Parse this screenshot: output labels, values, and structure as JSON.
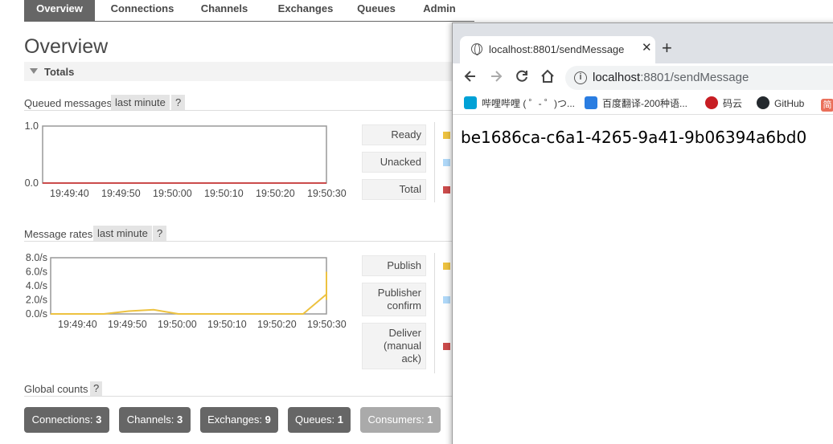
{
  "nav": {
    "tabs": [
      {
        "label": "Overview",
        "active": true
      },
      {
        "label": "Connections",
        "active": false
      },
      {
        "label": "Channels",
        "active": false
      },
      {
        "label": "Exchanges",
        "active": false
      },
      {
        "label": "Queues",
        "active": false
      },
      {
        "label": "Admin",
        "active": false
      }
    ]
  },
  "page_title": "Overview",
  "totals_label": "Totals",
  "queued": {
    "title": "Queued messages",
    "range": "last minute",
    "help": "?",
    "legend": [
      {
        "label": "Ready",
        "color": "#edc240"
      },
      {
        "label": "Unacked",
        "color": "#afd8f8"
      },
      {
        "label": "Total",
        "color": "#cb4b4b"
      }
    ]
  },
  "rates": {
    "title": "Message rates",
    "range": "last minute",
    "help": "?",
    "legend": [
      {
        "label": "Publish",
        "color": "#edc240"
      },
      {
        "label": "Publisher confirm",
        "lines": [
          "Publisher",
          "confirm"
        ],
        "color": "#afd8f8"
      },
      {
        "label": "Deliver (manual ack)",
        "lines": [
          "Deliver",
          "(manual",
          "ack)"
        ],
        "color": "#cb4b4b"
      }
    ]
  },
  "chart_data": [
    {
      "type": "line",
      "title": "Queued messages",
      "x": [
        "19:49:40",
        "19:49:50",
        "19:50:00",
        "19:50:10",
        "19:50:20",
        "19:50:30"
      ],
      "y_ticks": [
        "1.0",
        "0.0"
      ],
      "ylim": [
        0,
        1
      ],
      "series": [
        {
          "name": "Total",
          "color": "#cb4b4b",
          "values": [
            0,
            0,
            0,
            0,
            0,
            0
          ]
        }
      ]
    },
    {
      "type": "line",
      "title": "Message rates",
      "x": [
        "19:49:40",
        "19:49:50",
        "19:50:00",
        "19:50:10",
        "19:50:20",
        "19:50:30"
      ],
      "y_ticks": [
        "8.0/s",
        "6.0/s",
        "4.0/s",
        "2.0/s",
        "0.0/s"
      ],
      "ylim": [
        0,
        8
      ],
      "series": [
        {
          "name": "Publish",
          "color": "#edc240",
          "points": [
            [
              -10,
              0
            ],
            [
              0,
              0
            ],
            [
              5,
              0
            ],
            [
              10,
              0.4
            ],
            [
              15,
              0.6
            ],
            [
              20,
              0
            ],
            [
              30,
              0
            ],
            [
              40,
              0
            ],
            [
              45,
              0
            ],
            [
              50,
              2.8
            ],
            [
              55,
              6.0
            ],
            [
              60,
              2.0
            ]
          ]
        }
      ]
    }
  ],
  "global_counts": {
    "title": "Global counts",
    "help": "?",
    "items": [
      {
        "label": "Connections:",
        "value": "3",
        "dim": false
      },
      {
        "label": "Channels:",
        "value": "3",
        "dim": false
      },
      {
        "label": "Exchanges:",
        "value": "9",
        "dim": false
      },
      {
        "label": "Queues:",
        "value": "1",
        "dim": false
      },
      {
        "label": "Consumers:",
        "value": "1",
        "dim": true
      }
    ]
  },
  "browser": {
    "tab_title": "localhost:8801/sendMessage",
    "close": "✕",
    "new_tab": "+",
    "url_host": "localhost",
    "url_path": ":8801/sendMessage",
    "bookmarks": [
      {
        "label": "哔哩哔哩 ( ゜- ゜)つ...",
        "icon": "bilibili-icon",
        "color": "#00a1d6"
      },
      {
        "label": "百度翻译-200种语...",
        "icon": "baidu-translate-icon",
        "color": "#2a7de1"
      },
      {
        "label": "码云",
        "icon": "gitee-icon",
        "color": "#c71d23"
      },
      {
        "label": "GitHub",
        "icon": "github-icon",
        "color": "#24292e"
      },
      {
        "label": "简",
        "icon": "jian-icon",
        "color": "#ea6f5a"
      }
    ],
    "page_text": "be1686ca-c6a1-4265-9a41-9b06394a6bd0"
  }
}
